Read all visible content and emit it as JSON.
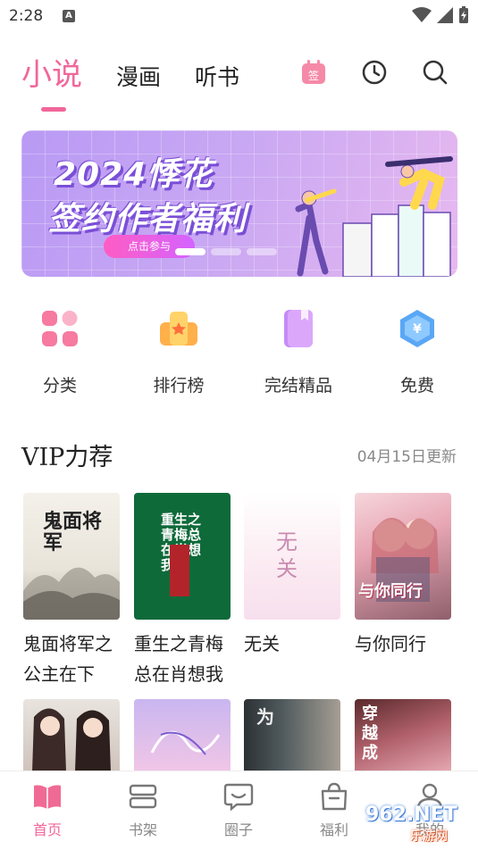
{
  "status": {
    "time": "2:28",
    "badge": "A"
  },
  "tabs": [
    {
      "label": "小说",
      "active": true
    },
    {
      "label": "漫画"
    },
    {
      "label": "听书"
    }
  ],
  "top_icons": {
    "sign": "签"
  },
  "banner": {
    "line1": "2024悸花",
    "line2": "签约作者福利",
    "cta": "点击参与"
  },
  "entries": [
    {
      "label": "分类",
      "icon": "category-icon"
    },
    {
      "label": "排行榜",
      "icon": "ranking-icon"
    },
    {
      "label": "完结精品",
      "icon": "book-icon"
    },
    {
      "label": "免费",
      "icon": "free-icon"
    }
  ],
  "section": {
    "title": "VIP力荐",
    "updated": "04月15日更新"
  },
  "books": [
    {
      "title": "鬼面将军之公主在下",
      "cover_text": "鬼面将军"
    },
    {
      "title": "重生之青梅总在肖想我",
      "cover_text": "重生之青梅总在肖想我"
    },
    {
      "title": "无关",
      "cover_text": "无关"
    },
    {
      "title": "与你同行",
      "cover_text": "与你同行"
    }
  ],
  "books_row2": [
    {
      "cover_text": ""
    },
    {
      "cover_text": ""
    },
    {
      "cover_text": "为"
    },
    {
      "cover_text": "穿越成"
    }
  ],
  "bottom_nav": [
    {
      "label": "首页",
      "active": true
    },
    {
      "label": "书架"
    },
    {
      "label": "圈子"
    },
    {
      "label": "福利"
    },
    {
      "label": "我的"
    }
  ],
  "watermark": {
    "text": "962.NET",
    "sub": "乐游网"
  },
  "colors": {
    "accent": "#f0679a",
    "purple": "#b38cf0"
  }
}
